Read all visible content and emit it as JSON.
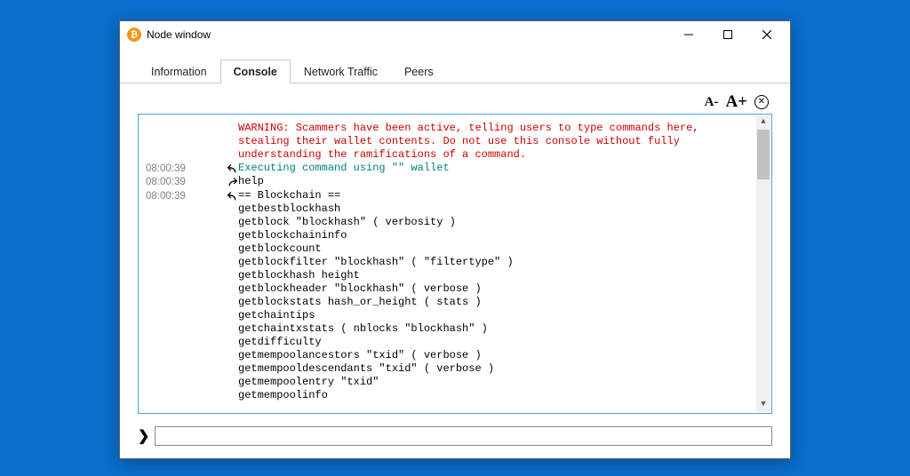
{
  "window": {
    "title": "Node window"
  },
  "tabs": [
    {
      "label": "Information"
    },
    {
      "label": "Console"
    },
    {
      "label": "Network Traffic"
    },
    {
      "label": "Peers"
    }
  ],
  "active_tab": "Console",
  "toolbar": {
    "font_minus": "A-",
    "font_plus": "A+",
    "clear": "✕"
  },
  "console": {
    "warning": "WARNING: Scammers have been active, telling users to type commands here, stealing their wallet contents. Do not use this console without fully understanding the ramifications of a command.",
    "entries": [
      {
        "time": "08:00:39",
        "dir": "out",
        "style": "teal",
        "text": "Executing command using \"\" wallet"
      },
      {
        "time": "08:00:39",
        "dir": "in",
        "style": "cmd",
        "text": "help"
      },
      {
        "time": "08:00:39",
        "dir": "out",
        "style": "body",
        "text": "== Blockchain ==\ngetbestblockhash\ngetblock \"blockhash\" ( verbosity )\ngetblockchaininfo\ngetblockcount\ngetblockfilter \"blockhash\" ( \"filtertype\" )\ngetblockhash height\ngetblockheader \"blockhash\" ( verbose )\ngetblockstats hash_or_height ( stats )\ngetchaintips\ngetchaintxstats ( nblocks \"blockhash\" )\ngetdifficulty\ngetmempoolancestors \"txid\" ( verbose )\ngetmempooldescendants \"txid\" ( verbose )\ngetmempoolentry \"txid\"\ngetmempoolinfo"
      }
    ]
  },
  "input": {
    "prompt": "❯",
    "value": ""
  }
}
